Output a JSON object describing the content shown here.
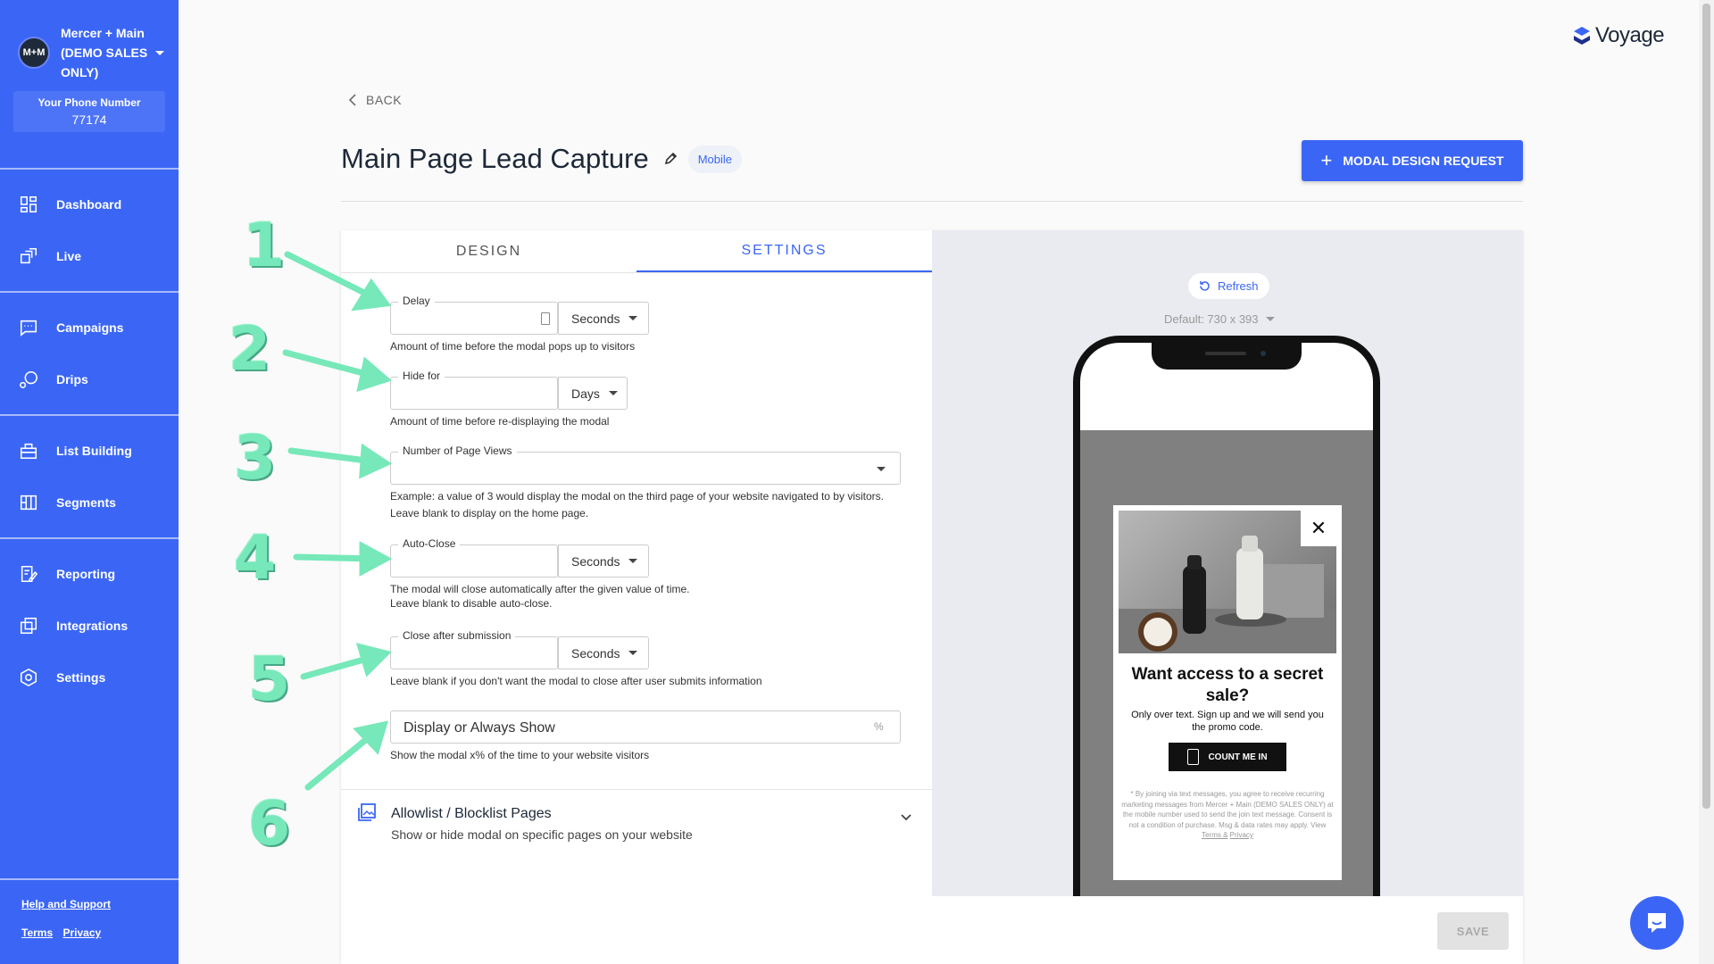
{
  "sidebar": {
    "avatar": "M+M",
    "account_name": "Mercer + Main (DEMO SALES ONLY)",
    "phone_label": "Your Phone Number",
    "phone_number": "77174",
    "groups": [
      [
        {
          "label": "Dashboard",
          "icon": "dashboard-icon"
        },
        {
          "label": "Live",
          "icon": "live-icon"
        }
      ],
      [
        {
          "label": "Campaigns",
          "icon": "campaigns-icon"
        },
        {
          "label": "Drips",
          "icon": "drips-icon"
        }
      ],
      [
        {
          "label": "List Building",
          "icon": "list-building-icon"
        },
        {
          "label": "Segments",
          "icon": "segments-icon"
        }
      ],
      [
        {
          "label": "Reporting",
          "icon": "reporting-icon"
        },
        {
          "label": "Integrations",
          "icon": "integrations-icon"
        },
        {
          "label": "Settings",
          "icon": "settings-icon"
        }
      ]
    ],
    "help": "Help and Support",
    "terms": "Terms",
    "privacy": "Privacy"
  },
  "header": {
    "brand": "Voyage",
    "back": "BACK",
    "title": "Main Page Lead Capture",
    "badge": "Mobile",
    "request_button": "MODAL DESIGN REQUEST"
  },
  "tabs": [
    "DESIGN",
    "SETTINGS"
  ],
  "form": {
    "delay": {
      "label": "Delay",
      "value": "",
      "unit": "Seconds",
      "helper": "Amount of time before the modal pops up to visitors"
    },
    "hide_for": {
      "label": "Hide for",
      "value": "",
      "unit": "Days",
      "helper": "Amount of time before re-displaying the modal"
    },
    "page_views": {
      "label": "Number of Page Views",
      "value": "",
      "helper": "Example: a value of 3 would display the modal on the third page of your website navigated to by visitors. Leave blank to display on the home page."
    },
    "auto_close": {
      "label": "Auto-Close",
      "value": "",
      "unit": "Seconds",
      "helper_1": "The modal will close automatically after the given value of time.",
      "helper_2": "Leave blank to disable auto-close."
    },
    "close_after": {
      "label": "Close after submission",
      "value": "",
      "unit": "Seconds",
      "helper": "Leave blank if you don't want the modal to close after user submits information"
    },
    "display": {
      "placeholder": "Display or Always Show",
      "suffix": "%",
      "helper": "Show the modal x% of the time to your website visitors"
    }
  },
  "accordion": {
    "title": "Allowlist / Blocklist Pages",
    "subtitle": "Show or hide modal on specific pages on your website"
  },
  "preview": {
    "refresh": "Refresh",
    "default_size": "Default: 730 x 393",
    "close_symbol": "✕",
    "headline": "Want access to a secret sale?",
    "body": "Only over text. Sign up and we will send you the promo code.",
    "cta": "COUNT ME IN",
    "fineprint": "* By joining via text messages, you agree to receive recurring marketing messages from Mercer + Main (DEMO SALES ONLY) at the mobile number used to send the join text message. Consent is not a condition of purchase. Msg & data rates may apply. View",
    "fineprint_terms": "Terms &",
    "fineprint_privacy": "Privacy",
    "save": "SAVE"
  },
  "annotations": [
    "1",
    "2",
    "3",
    "4",
    "5",
    "6"
  ],
  "colors": {
    "primary": "#3b66f5",
    "annotation": "#77e8b9",
    "title": "#1d2838"
  }
}
